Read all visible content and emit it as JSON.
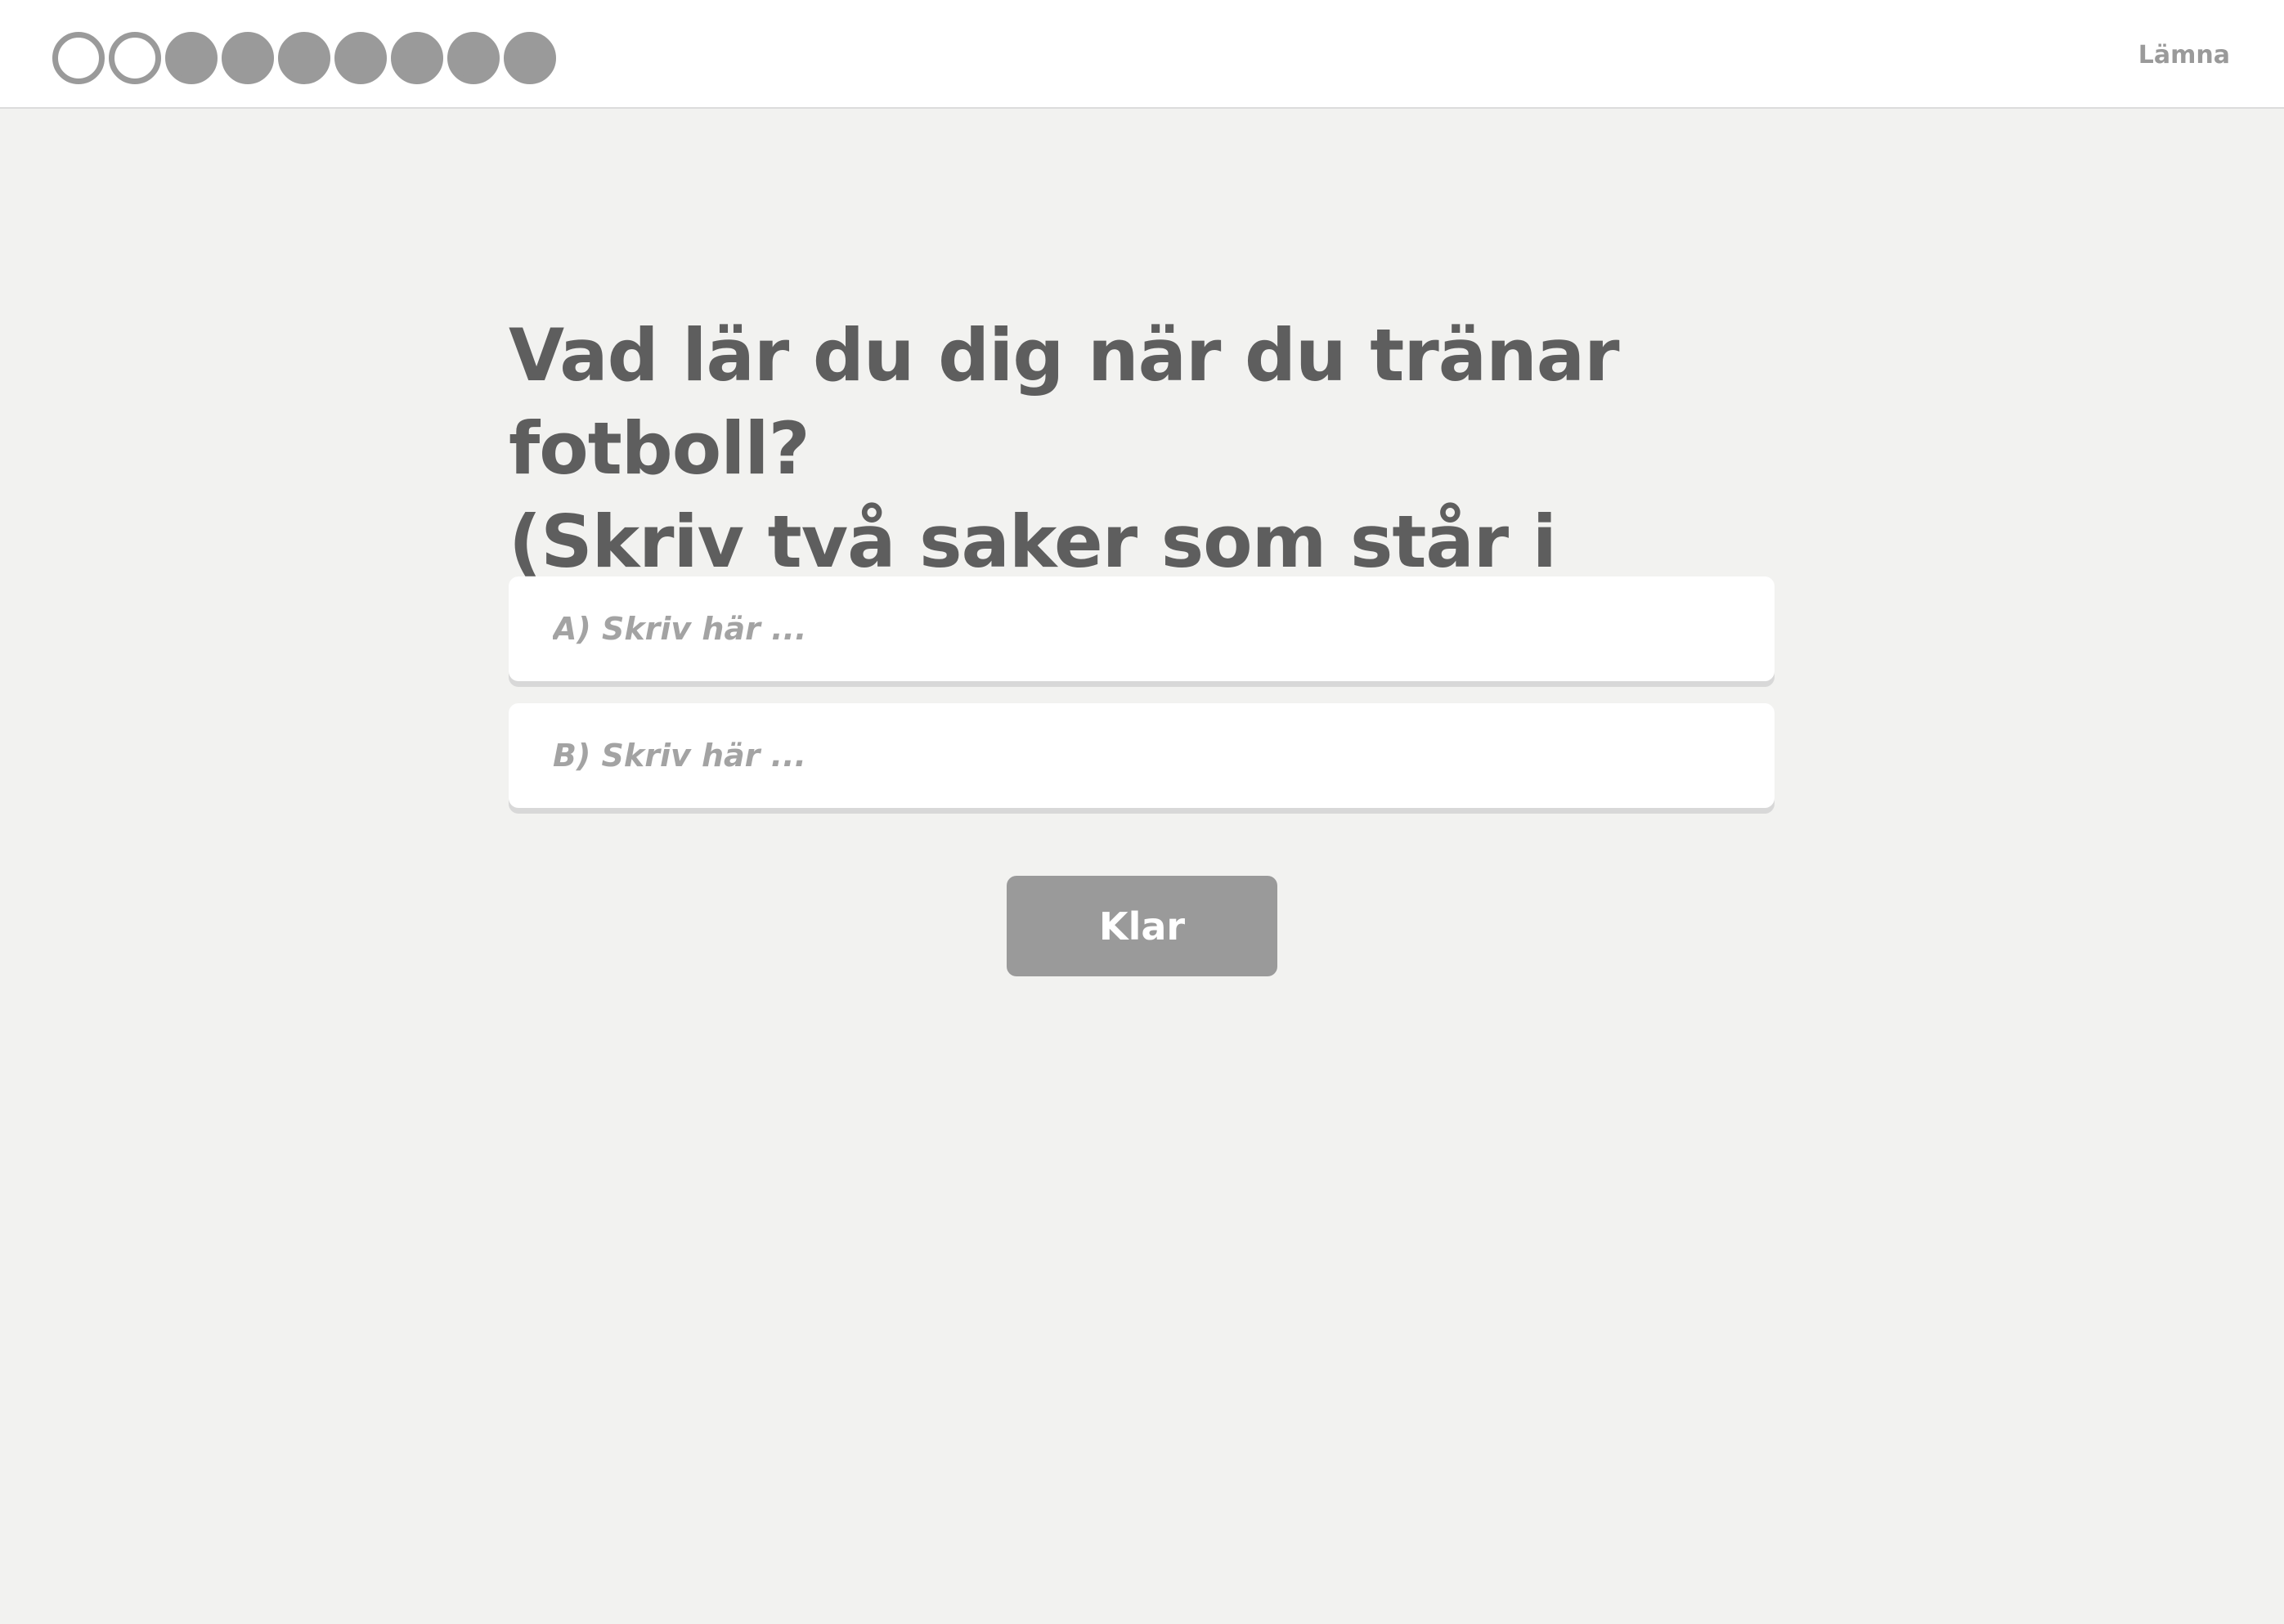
{
  "header": {
    "progress": {
      "total": 9,
      "completed": 2
    },
    "leave_label": "Lämna"
  },
  "question": {
    "line1": "Vad lär du dig när du tränar fotboll?",
    "line2": "(Skriv två saker som står i texten)"
  },
  "answers": {
    "a": {
      "placeholder": "A) Skriv här ...",
      "value": ""
    },
    "b": {
      "placeholder": "B) Skriv här ...",
      "value": ""
    }
  },
  "submit_label": "Klar",
  "colors": {
    "background": "#f2f2f0",
    "topbar": "#ffffff",
    "progress": "#9a9a9a",
    "question_text": "#5e5e5e",
    "button": "#9a9a9a"
  }
}
